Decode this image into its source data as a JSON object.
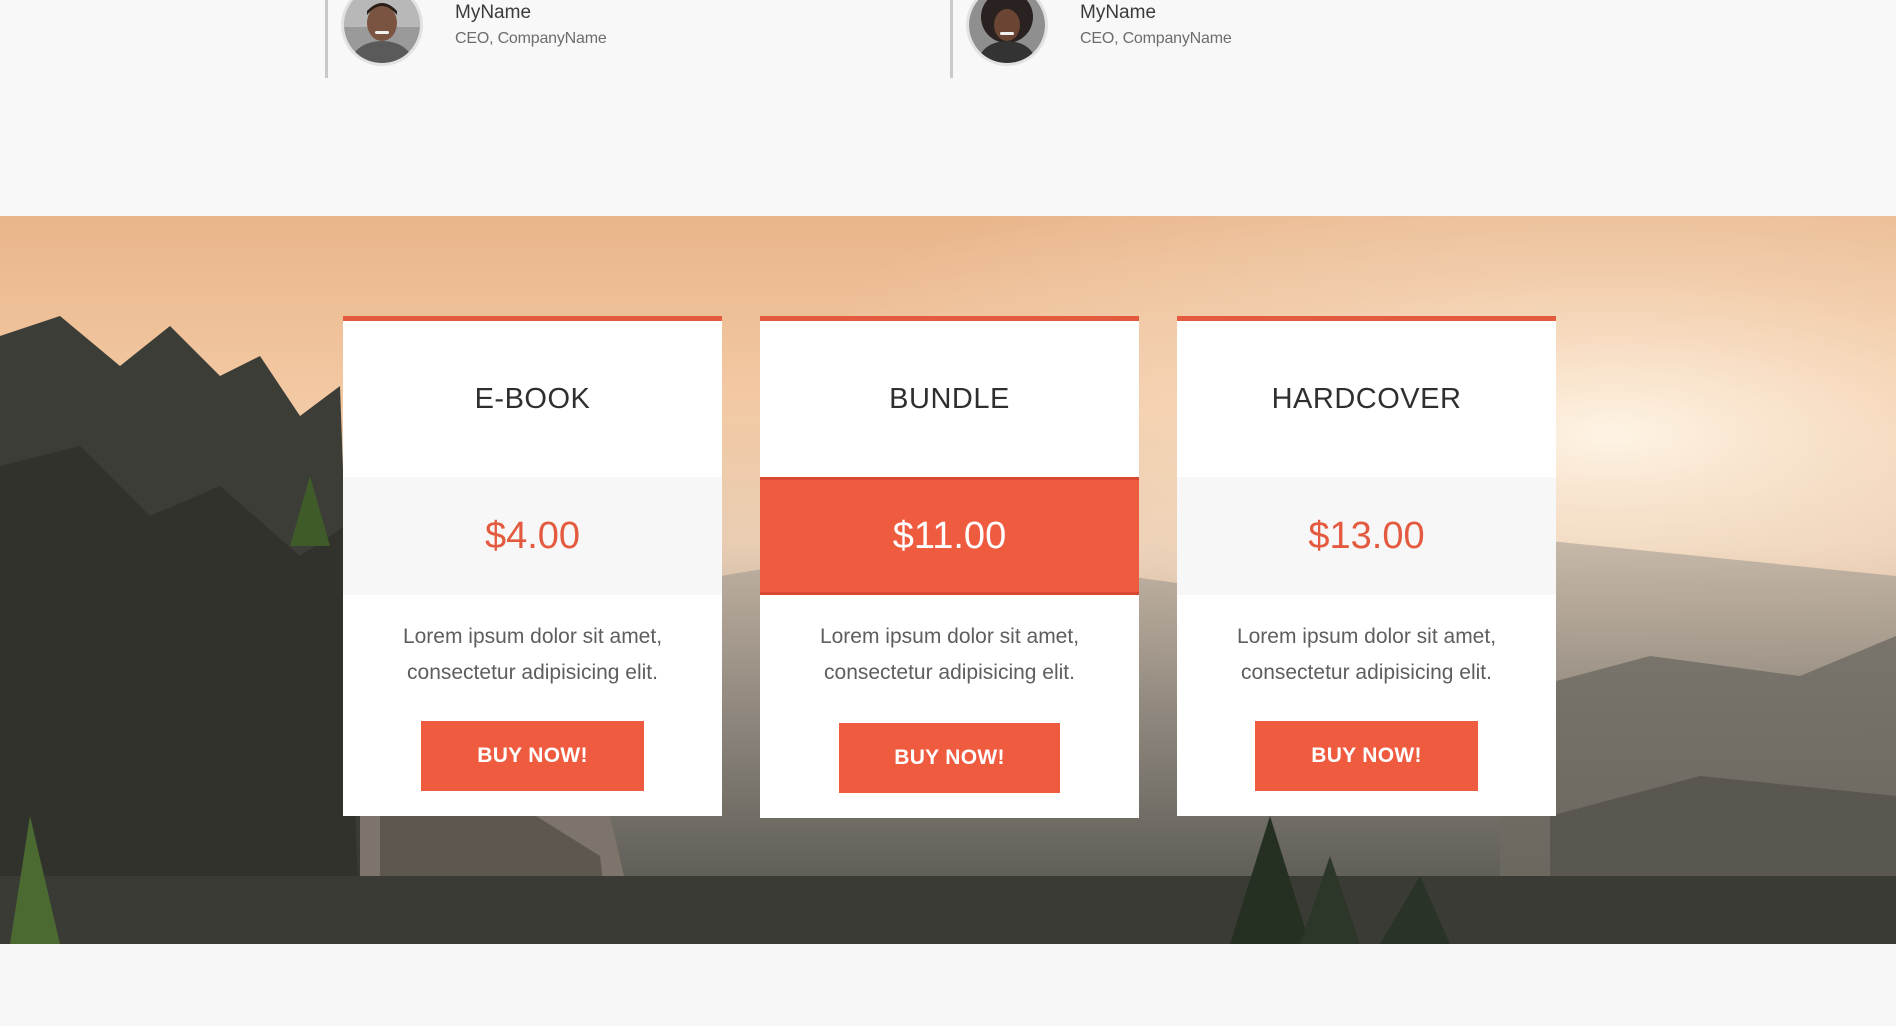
{
  "testimonials": [
    {
      "name": "MyName",
      "role": "CEO, CompanyName",
      "avatar_icon": "man-portrait-avatar"
    },
    {
      "name": "MyName",
      "role": "CEO, CompanyName",
      "avatar_icon": "woman-portrait-avatar"
    }
  ],
  "pricing": {
    "background": "mountain-sunset-photo",
    "accent_color": "#ef5b3f",
    "plans": [
      {
        "title": "E-BOOK",
        "price": "$4.00",
        "description": "Lorem ipsum dolor sit amet, consectetur adipisicing elit.",
        "button_label": "BUY NOW!",
        "featured": false
      },
      {
        "title": "BUNDLE",
        "price": "$11.00",
        "description": "Lorem ipsum dolor sit amet, consectetur adipisicing elit.",
        "button_label": "BUY NOW!",
        "featured": true
      },
      {
        "title": "HARDCOVER",
        "price": "$13.00",
        "description": "Lorem ipsum dolor sit amet, consectetur adipisicing elit.",
        "button_label": "BUY NOW!",
        "featured": false
      }
    ]
  }
}
